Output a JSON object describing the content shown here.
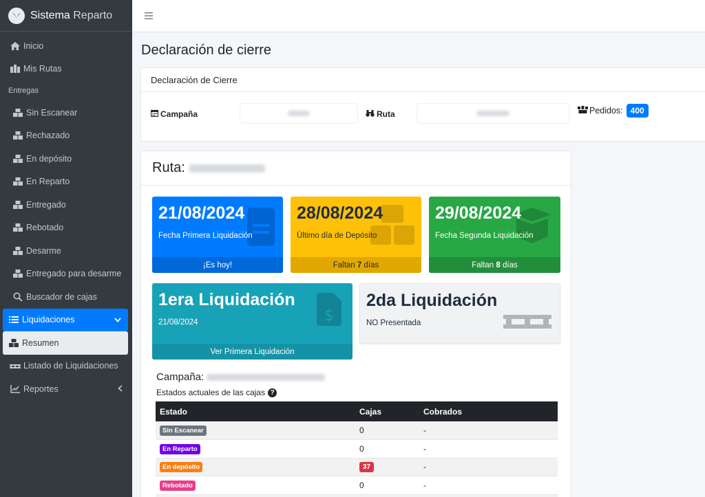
{
  "app": {
    "name_bold": "Sistema",
    "name_light": "Reparto"
  },
  "sidebar": {
    "items": [
      {
        "label": "Inicio",
        "icon": "home-icon"
      },
      {
        "label": "Mis Rutas",
        "icon": "route-icon"
      }
    ],
    "section_header": "Entregas",
    "entregas": [
      {
        "label": "Sin Escanear",
        "icon": "boxes-icon"
      },
      {
        "label": "Rechazado",
        "icon": "boxes-icon"
      },
      {
        "label": "En depósito",
        "icon": "boxes-icon"
      },
      {
        "label": "En Reparto",
        "icon": "boxes-icon"
      },
      {
        "label": "Entregado",
        "icon": "boxes-icon"
      },
      {
        "label": "Rebotado",
        "icon": "boxes-icon"
      },
      {
        "label": "Desarme",
        "icon": "boxes-icon"
      },
      {
        "label": "Entregado para desarme",
        "icon": "boxes-icon"
      },
      {
        "label": "Buscador de cajas",
        "icon": "search-icon"
      }
    ],
    "liquidaciones": {
      "label": "Liquidaciones",
      "icon": "list-icon"
    },
    "resumen": {
      "label": "Resumen",
      "icon": "boxes-icon"
    },
    "listado": {
      "label": "Listado de Liquidaciones",
      "icon": "pallet-icon"
    },
    "reportes": {
      "label": "Reportes",
      "icon": "chart-line-icon"
    }
  },
  "page": {
    "title": "Declaración de cierre"
  },
  "filters": {
    "card_title": "Declaración de Cierre",
    "campana_label": "Campaña",
    "ruta_label": "Ruta",
    "pedidos_label": "Pedidos:",
    "pedidos_count": "400"
  },
  "ruta": {
    "label": "Ruta:"
  },
  "boxes": {
    "primera": {
      "date": "21/08/2024",
      "label": "Fecha Primera Liquidación",
      "footer": "¡Es hoy!"
    },
    "deposito": {
      "date": "28/08/2024",
      "label": "Último día de Depósito",
      "footer_pre": "Faltan",
      "footer_num": "7",
      "footer_post": "días"
    },
    "segunda": {
      "date": "29/08/2024",
      "label": "Fecha Segunda Liquidación",
      "footer_pre": "Faltan",
      "footer_num": "8",
      "footer_post": "días"
    },
    "liq1": {
      "title": "1era Liquidación",
      "date": "21/08/2024",
      "footer": "Ver Primera Liquidación"
    },
    "liq2": {
      "title": "2da Liquidación",
      "status": "NO Presentada"
    }
  },
  "campaign": {
    "label": "Campaña:"
  },
  "estados": {
    "title": "Estados actuales de las cajas"
  },
  "table": {
    "headers": [
      "Estado",
      "Cajas",
      "Cobrados"
    ],
    "rows": [
      {
        "estado": "Sin Escanear",
        "color": "#6c757d",
        "cajas": "0",
        "cobrados": "-"
      },
      {
        "estado": "En Reparto",
        "color": "#6f00e6",
        "cajas": "0",
        "cobrados": "-"
      },
      {
        "estado": "En depósito",
        "color": "#fd7e14",
        "cajas": "37",
        "cobrados": "-"
      },
      {
        "estado": "Rebotado",
        "color": "#e83e8c",
        "cajas": "0",
        "cobrados": "-"
      }
    ]
  }
}
